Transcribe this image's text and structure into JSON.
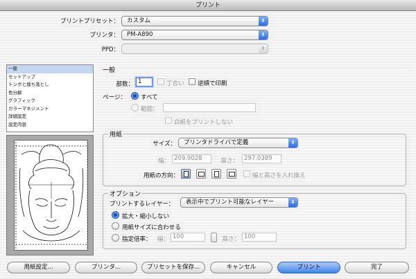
{
  "window": {
    "title": "プリント"
  },
  "top": {
    "preset_label": "プリントプリセット：",
    "preset_value": "カスタム",
    "printer_label": "プリンタ：",
    "printer_value": "PM-A890",
    "ppd_label": "PPD：",
    "ppd_value": ""
  },
  "sidebar": {
    "items": [
      "一般",
      "セットアップ",
      "トンボと裁ち落とし",
      "色分解",
      "グラフィック",
      "カラーマネジメント",
      "詳細設定",
      "設定内容"
    ],
    "selected_index": 0
  },
  "general": {
    "section_title": "一般",
    "copies_label": "部数：",
    "copies_value": "1",
    "collate_label": "丁合い",
    "reverse_label": "逆順で印刷",
    "pages_label": "ページ：",
    "all_label": "すべて",
    "range_label": "範囲：",
    "range_value": "",
    "blank_label": "白紙をプリントしない"
  },
  "paper": {
    "section_title": "用紙",
    "size_label": "サイズ：",
    "size_value": "プリンタドライバで定義",
    "width_label": "幅：",
    "width_value": "209.9028",
    "height_label": "高さ：",
    "height_value": "297.0389",
    "orientation_label": "用紙の方向：",
    "swap_label": "幅と高さを入れ換え"
  },
  "options": {
    "section_title": "オプション",
    "layer_label": "プリントするレイヤー：",
    "layer_value": "表示中でプリント可能なレイヤー",
    "no_scale_label": "拡大・縮小しない",
    "fit_label": "用紙サイズに合わせる",
    "scale_label": "指定倍率：",
    "scale_w_label": "幅：",
    "scale_w_value": "100",
    "scale_h_label": "高さ：",
    "scale_h_value": "100"
  },
  "buttons": {
    "page_setup": "用紙設定...",
    "printer": "プリンタ...",
    "save_preset": "プリセットを保存...",
    "cancel": "キャンセル",
    "print": "プリント",
    "done": "完了"
  },
  "colors": {
    "accent": "#3f86e6",
    "selection": "#c4d6f0"
  }
}
